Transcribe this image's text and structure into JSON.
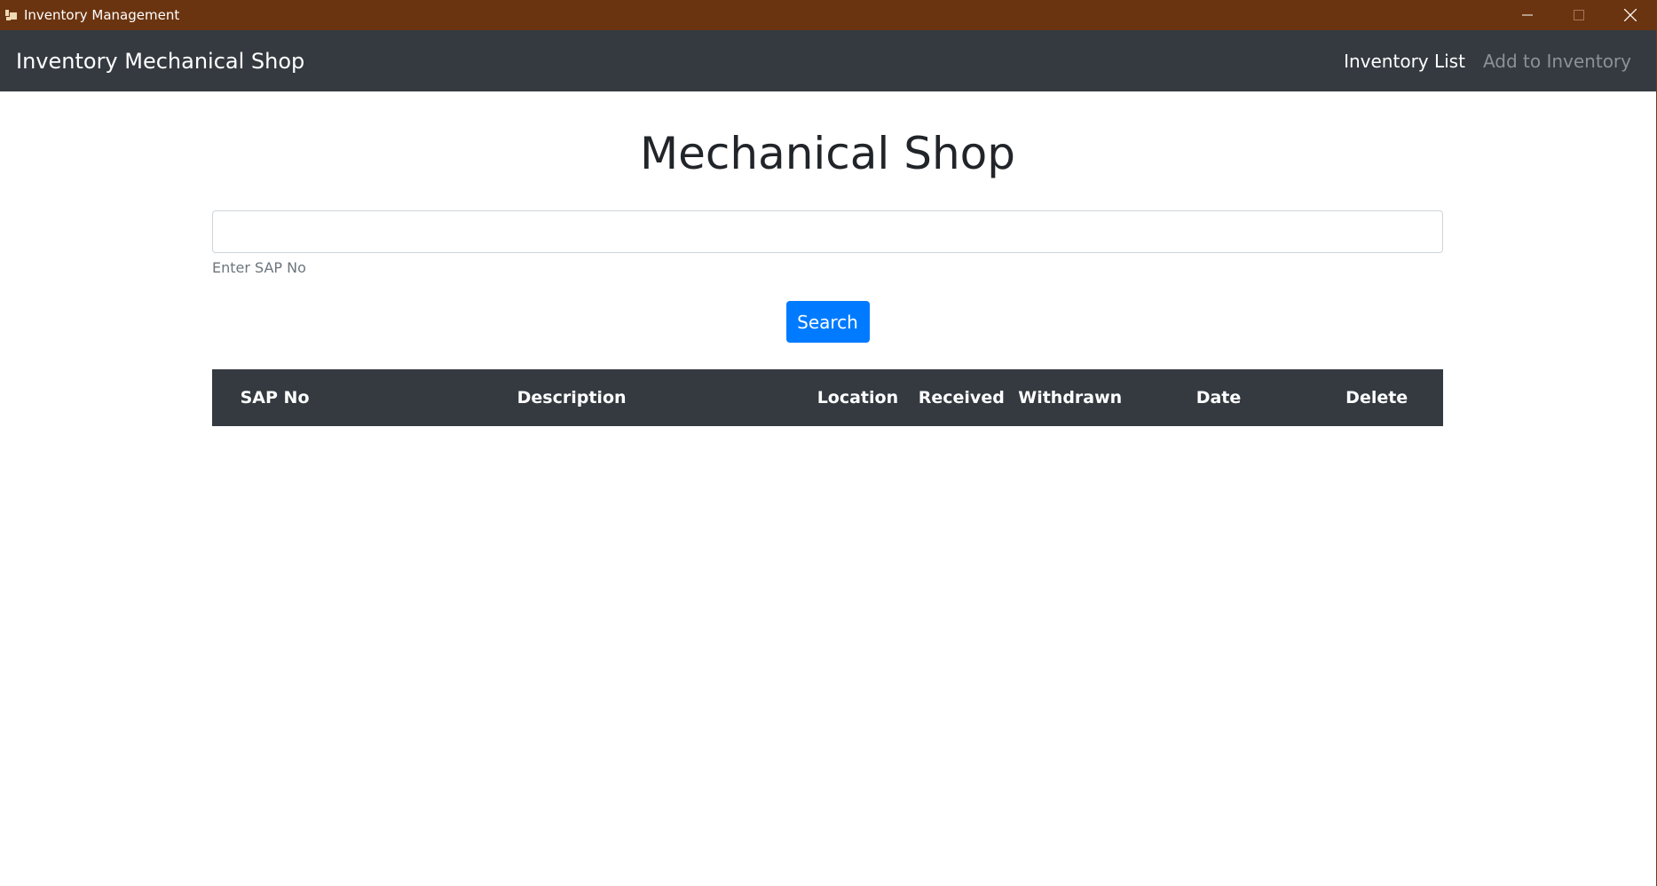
{
  "window": {
    "title": "Inventory Management",
    "controls": [
      "minimize-icon",
      "maximize-icon",
      "close-icon"
    ],
    "titlebar_color": "#6b3410"
  },
  "navbar": {
    "brand": "Inventory Mechanical Shop",
    "links": [
      {
        "label": "Inventory List",
        "active": true
      },
      {
        "label": "Add to Inventory",
        "active": false
      }
    ],
    "background": "#343a40"
  },
  "main": {
    "title": "Mechanical Shop",
    "search": {
      "value": "",
      "helper": "Enter SAP No"
    },
    "search_button": "Search",
    "accent": "#007bff",
    "table": {
      "headers": [
        "SAP No",
        "Description",
        "Location",
        "Received",
        "Withdrawn",
        "Date",
        "Delete"
      ],
      "rows": []
    }
  }
}
